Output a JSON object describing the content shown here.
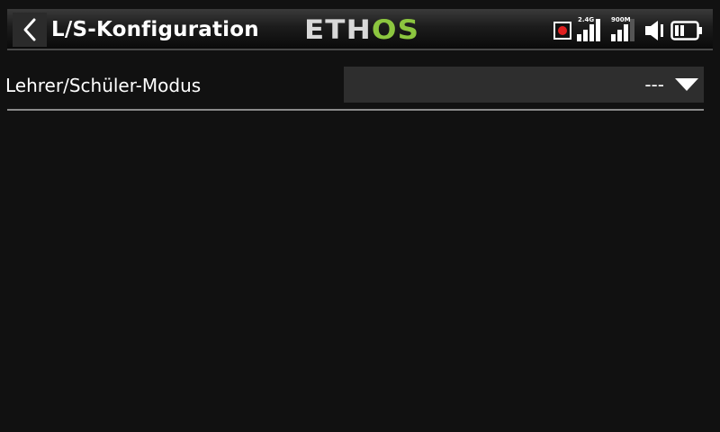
{
  "header": {
    "title": "L/S-Konfiguration",
    "back_icon": "chevron-left-icon",
    "logo": {
      "part1": "ETH",
      "part2": "OS"
    },
    "status": {
      "record_icon": "record-icon",
      "signal_24": {
        "label": "2.4G",
        "level": 4,
        "max": 4
      },
      "signal_900": {
        "label": "900M",
        "level": 3,
        "max": 4
      },
      "audio_icon": "speaker-icon",
      "battery_icon": "battery-icon",
      "battery_level_fraction": 0.33
    }
  },
  "settings": {
    "mode_label": "Lehrer/Schüler-Modus",
    "mode_value": "---",
    "dropdown_icon": "chevron-down-icon"
  },
  "colors": {
    "background": "#111111",
    "accent_logo": "#8cc63f",
    "record_dot": "#e02020",
    "select_bg": "#2e2e2e",
    "divider": "#8a8a8a"
  }
}
